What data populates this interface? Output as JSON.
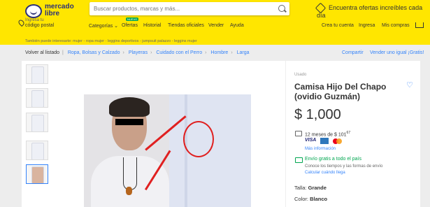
{
  "header": {
    "logo_line1": "mercado",
    "logo_line2": "libre",
    "search_placeholder": "Buscar productos, marcas y más...",
    "promo": "Encuentra ofertas increíbles cada día",
    "location_line1": "Ingresa tu",
    "location_line2": "código postal",
    "nav": [
      {
        "label": "Categorías ⌄"
      },
      {
        "label": "Ofertas",
        "badge": "NUEVO"
      },
      {
        "label": "Historial"
      },
      {
        "label": "Tiendas oficiales"
      },
      {
        "label": "Vender"
      },
      {
        "label": "Ayuda"
      }
    ],
    "account": [
      "Crea tu cuenta",
      "Ingresa",
      "Mis compras"
    ]
  },
  "similar_searches": "También puede interesarte: mujer - ropa mujer - leggins deportivos - jumpsuit palazzo - leggins mujer",
  "breadcrumb": {
    "back": "Volver al listado",
    "items": [
      "Ropa, Bolsas y Calzado",
      "Playeras",
      "Cuidado con el Perro",
      "Hombre",
      "Larga"
    ],
    "share": "Compartir",
    "sell_same": "Vender uno igual ¡Gratis!"
  },
  "product": {
    "condition": "Usado",
    "title": "Camisa Hijo Del Chapo (ovidio Guzmán)",
    "price": "$ 1,000",
    "installments_prefix": "12 meses de $ 101",
    "installments_cents": "67",
    "payment_logos": [
      "VISA",
      "AMEX",
      "Mastercard"
    ],
    "more_info": "Más información",
    "shipping_title": "Envío gratis a todo el país",
    "shipping_sub": "Conoce los tiempos y las formas de envío",
    "shipping_link": "Calcular cuándo llega",
    "size_label": "Talla:",
    "size_value": "Grande",
    "color_label": "Color:",
    "color_value": "Blanco"
  },
  "colors": {
    "header_bg": "#ffe600",
    "link": "#3483fa",
    "green": "#00a650",
    "annotation": "#e02020"
  }
}
